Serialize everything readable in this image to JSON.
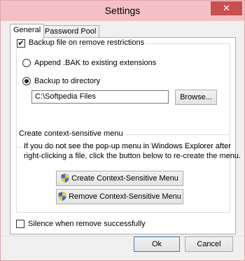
{
  "window": {
    "title": "Settings",
    "close_glyph": "✕"
  },
  "tabs": [
    {
      "label": "General",
      "active": true
    },
    {
      "label": "Password Pool",
      "active": false
    }
  ],
  "general": {
    "backup_checkbox": {
      "label": "Backup file on remove restrictions",
      "checked": true
    },
    "append_radio": {
      "label": "Append .BAK to existing extensions",
      "checked": false
    },
    "directory_radio": {
      "label": "Backup to directory",
      "checked": true
    },
    "directory_field": {
      "value": "C:\\Softpedia Files"
    },
    "browse_label": "Browse...",
    "context_group": {
      "title": "Create context-sensitive menu",
      "description_line1": "If you do not see the pop-up menu in Windows Explorer after",
      "description_line2": "right-clicking a file, click the button below to re-create the menu.",
      "create_label": "Create Context-Sensitive Menu",
      "remove_label": "Remove Context-Sensitive Menu"
    }
  },
  "silence_checkbox": {
    "label": "Silence when remove successfully",
    "checked": false
  },
  "footer": {
    "ok_label": "Ok",
    "cancel_label": "Cancel"
  },
  "check_glyph": "✔",
  "icons": {
    "close": "close-icon",
    "shield": "uac-shield-icon"
  }
}
